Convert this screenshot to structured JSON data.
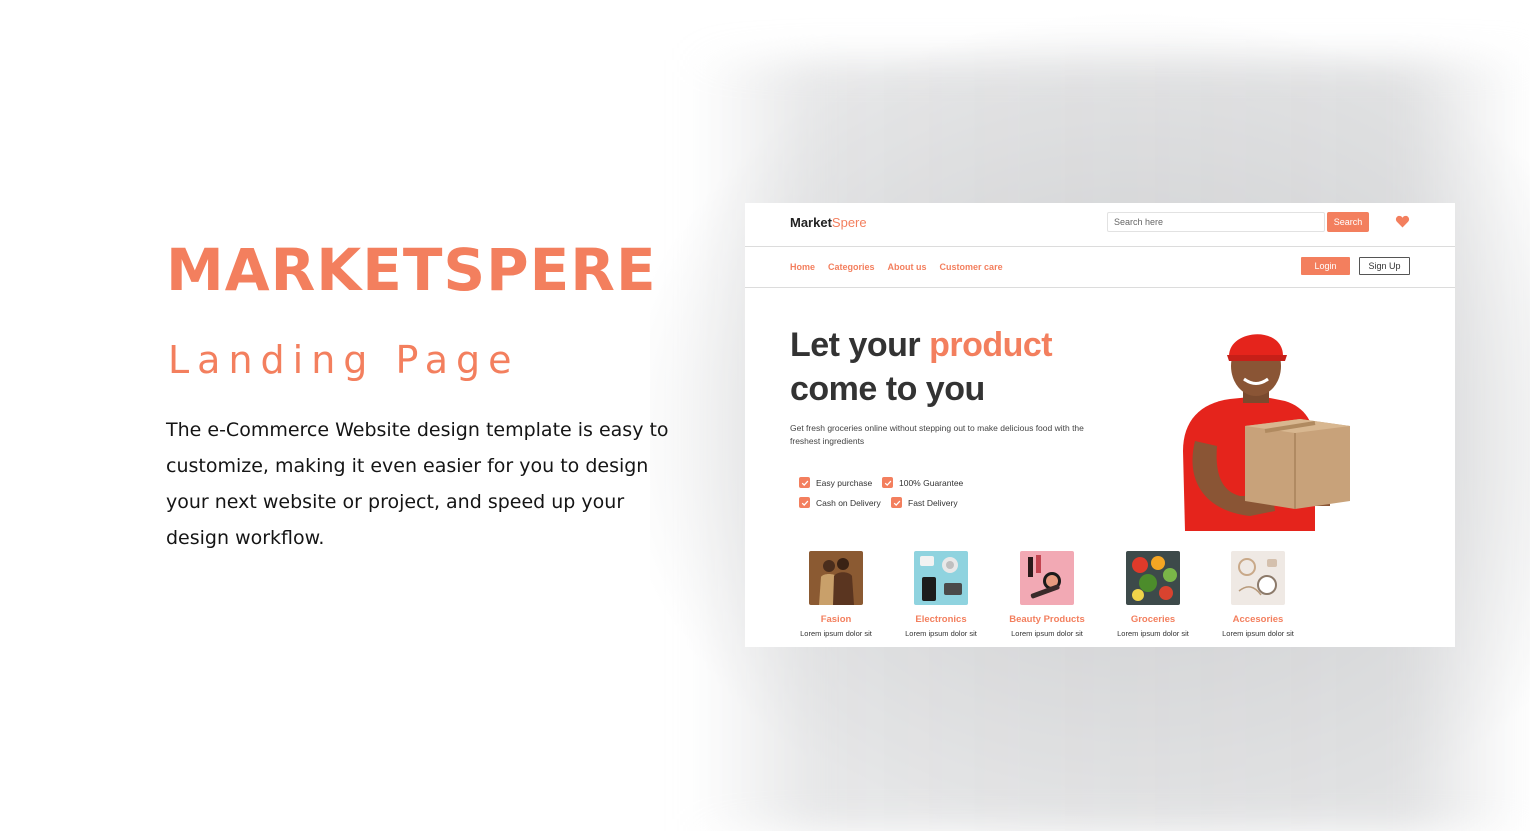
{
  "promo": {
    "title": "MARKETSPERE",
    "subtitle": "Landing Page",
    "description": "The e-Commerce Website design template is easy to customize, making it even easier for you to design your next website or project, and speed up your design workflow."
  },
  "mockup": {
    "logo": {
      "part1": "Market",
      "part2": "Spere"
    },
    "search": {
      "placeholder": "Search here",
      "button_label": "Search"
    },
    "nav": {
      "links": [
        "Home",
        "Categories",
        "About us",
        "Customer care"
      ],
      "login_label": "Login",
      "signup_label": "Sign Up"
    },
    "hero": {
      "title_part1": "Let your ",
      "title_accent": "product",
      "title_part2": "come to you",
      "description": "Get fresh groceries online without stepping out to make delicious food with the freshest ingredients",
      "features": [
        "Easy purchase",
        "100% Guarantee",
        "Cash on Delivery",
        "Fast Delivery"
      ]
    },
    "categories": [
      {
        "name": "Fasion",
        "desc": "Lorem ipsum dolor sit"
      },
      {
        "name": "Electronics",
        "desc": "Lorem ipsum dolor sit"
      },
      {
        "name": "Beauty Products",
        "desc": "Lorem ipsum dolor sit"
      },
      {
        "name": "Groceries",
        "desc": "Lorem ipsum dolor sit"
      },
      {
        "name": "Accesories",
        "desc": "Lorem ipsum dolor sit"
      }
    ]
  },
  "colors": {
    "accent": "#f37f5e",
    "text_dark": "#333333"
  }
}
